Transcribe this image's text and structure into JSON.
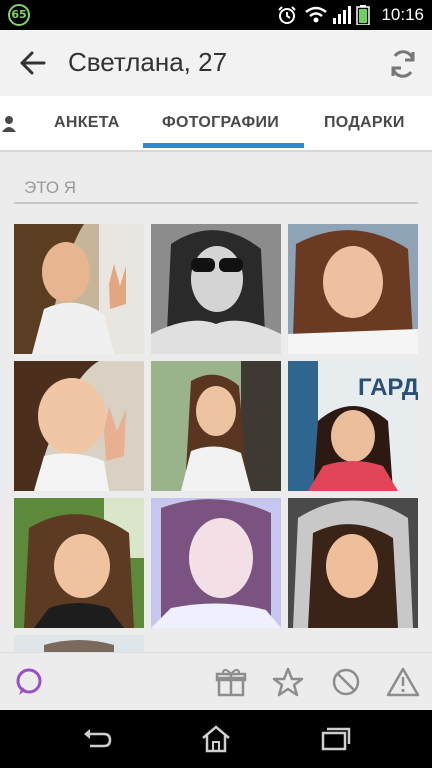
{
  "status_bar": {
    "badge": "65",
    "time": "10:16"
  },
  "app_bar": {
    "title": "Светлана, 27"
  },
  "tabs": [
    {
      "label": "АНКЕТА"
    },
    {
      "label": "ФОТОГРАФИИ",
      "active": true
    },
    {
      "label": "ПОДАРКИ"
    }
  ],
  "section": {
    "title": "ЭТО Я"
  },
  "photo_thumb_text": "ГАРД",
  "colors": {
    "accent": "#2a8ad4",
    "chat": "#9b4fc4",
    "icon_gray": "#9a9a9a"
  }
}
